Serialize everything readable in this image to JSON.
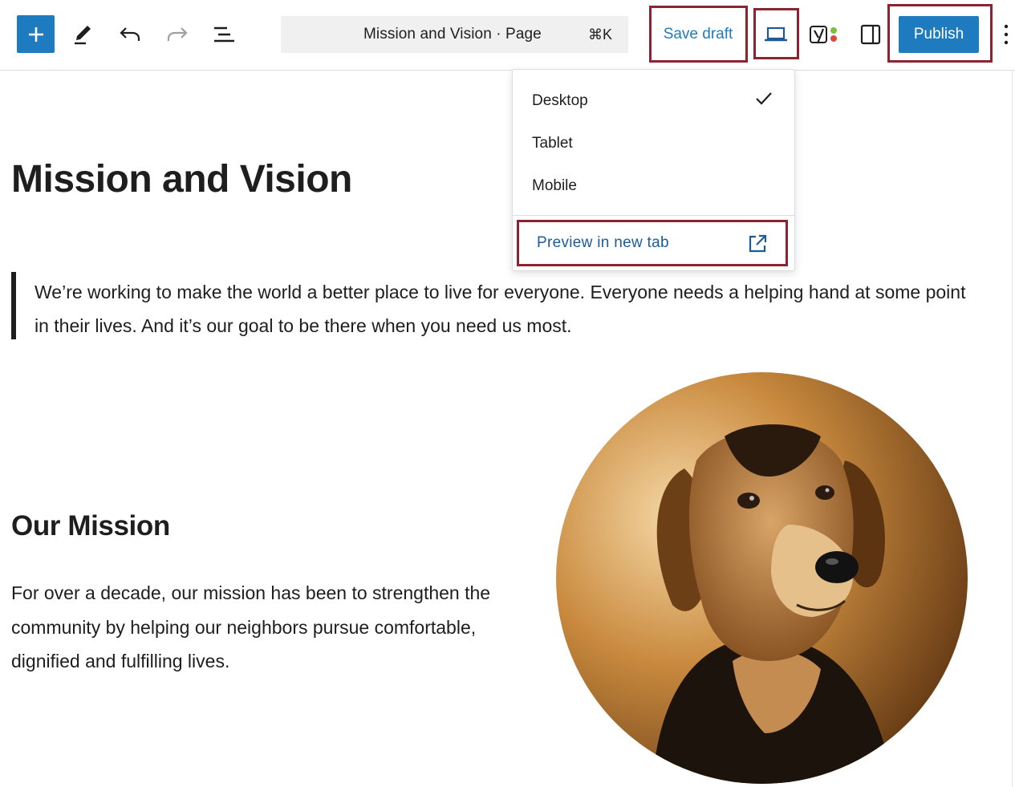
{
  "toolbar": {
    "add_icon": "plus-icon",
    "tools_icon": "pencil-icon",
    "undo_icon": "undo-icon",
    "redo_icon": "redo-icon",
    "outline_icon": "list-view-icon",
    "command_bar": {
      "title": "Mission and Vision · Page",
      "shortcut": "⌘K"
    },
    "save_draft_label": "Save draft",
    "preview_icon": "laptop-icon",
    "yoast_icon": "yoast-seo-icon",
    "settings_icon": "sidebar-toggle-icon",
    "publish_label": "Publish",
    "more_icon": "more-vertical-icon",
    "accent_color": "#1e7bc0",
    "highlight_color": "#8b2330"
  },
  "preview_menu": {
    "items": [
      {
        "label": "Desktop",
        "selected": true
      },
      {
        "label": "Tablet",
        "selected": false
      },
      {
        "label": "Mobile",
        "selected": false
      }
    ],
    "preview_label": "Preview in new tab",
    "preview_icon": "external-link-icon"
  },
  "content": {
    "heading": "Mission and Vision",
    "quote": "We’re working to make the world a better place to live for everyone. Everyone needs a helping hand at some point in their lives. And it’s our goal to be there when you need us most.",
    "mission_heading": "Our Mission",
    "mission_text": "For over a decade, our mission has been to strengthen the community by helping our neighbors pursue comfortable, dignified and fulfilling lives.",
    "image_subject": "dog-portrait"
  }
}
